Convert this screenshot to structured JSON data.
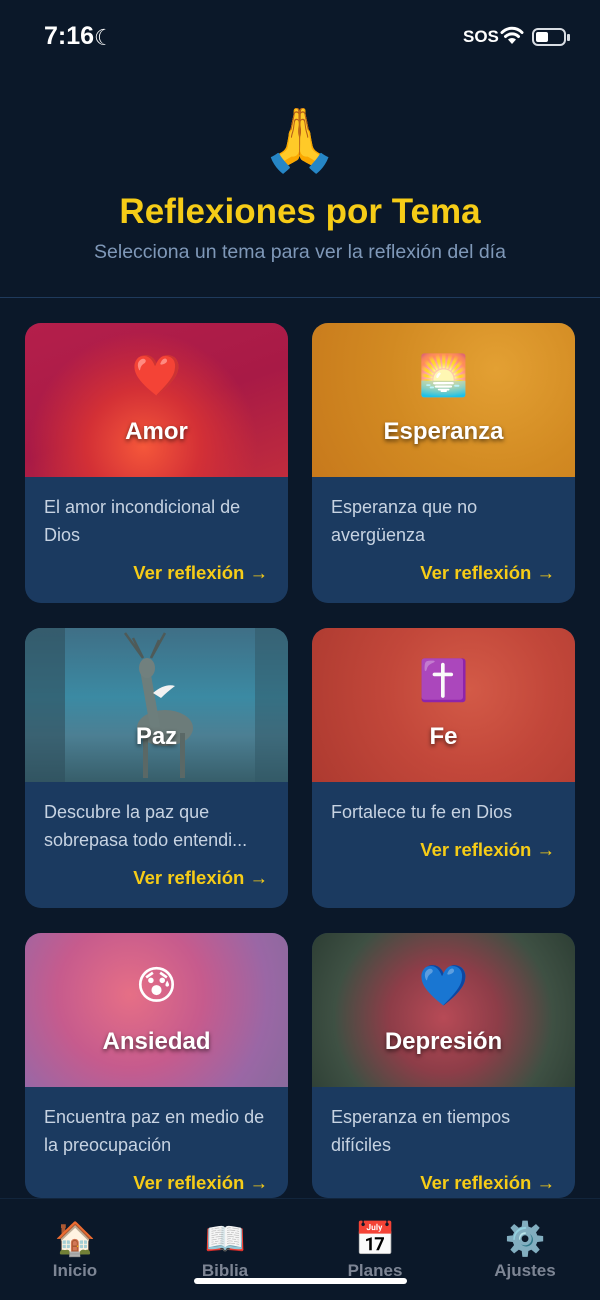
{
  "status_bar": {
    "time": "7:16",
    "sos": "SOS"
  },
  "header": {
    "icon": "🙏",
    "title": "Reflexiones por Tema",
    "subtitle": "Selecciona un tema para ver la reflexión del día"
  },
  "topics": [
    {
      "emoji": "❤️",
      "title": "Amor",
      "description": "El amor incondicional de Dios",
      "link": "Ver reflexión →"
    },
    {
      "emoji": "🌅",
      "title": "Esperanza",
      "description": "Esperanza que no avergüenza",
      "link": "Ver reflexión →"
    },
    {
      "emoji": "",
      "title": "Paz",
      "description": "Descubre la paz que sobrepasa todo entendi...",
      "link": "Ver reflexión →"
    },
    {
      "emoji": "✝️",
      "title": "Fe",
      "description": "Fortalece tu fe en Dios",
      "link": "Ver reflexión →"
    },
    {
      "emoji": "😰",
      "title": "Ansiedad",
      "description": "Encuentra paz en medio de la preocupación",
      "link": "Ver reflexión →"
    },
    {
      "emoji": "💙",
      "title": "Depresión",
      "description": "Esperanza en tiempos difíciles",
      "link": "Ver reflexión →"
    }
  ],
  "tabs": [
    {
      "icon": "🏠",
      "label": "Inicio"
    },
    {
      "icon": "📖",
      "label": "Biblia"
    },
    {
      "icon": "📅",
      "label": "Planes"
    },
    {
      "icon": "⚙️",
      "label": "Ajustes"
    }
  ],
  "colors": {
    "accent": "#f6cc17",
    "background": "#0b1829",
    "card": "#1b3a60"
  }
}
